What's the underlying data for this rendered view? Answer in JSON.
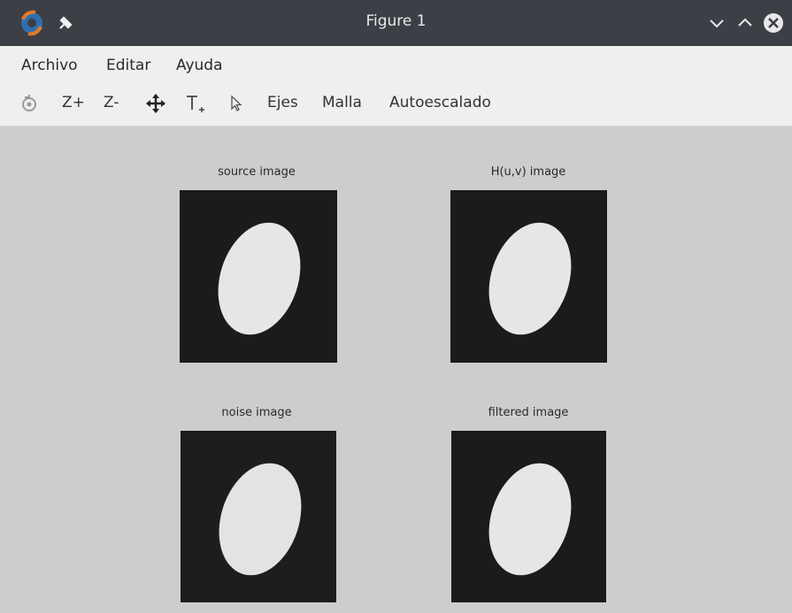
{
  "window": {
    "title": "Figure 1",
    "icons": {
      "app": "octave-logo-icon",
      "pin": "pin-icon",
      "minimize": "chevron-down-icon",
      "maximize": "chevron-up-icon",
      "close": "close-circle-icon"
    }
  },
  "menubar": {
    "items": [
      "Archivo",
      "Editar",
      "Ayuda"
    ]
  },
  "toolbar": {
    "rotate_icon": "rotate-icon",
    "zoom_in": "Z+",
    "zoom_out": "Z-",
    "pan_icon": "pan-arrows-icon",
    "text_icon": "text-insert-icon",
    "select_icon": "pointer-icon",
    "axes": "Ejes",
    "grid": "Malla",
    "autoscale": "Autoescalado"
  },
  "figure": {
    "background": "#cdcdcd",
    "panel_color": "#1b1b1b",
    "ellipse_color": "#e6e6e6",
    "subplots": [
      {
        "title": "source image"
      },
      {
        "title": "H(u,v) image"
      },
      {
        "title": "noise image"
      },
      {
        "title": "filtered image"
      }
    ]
  }
}
